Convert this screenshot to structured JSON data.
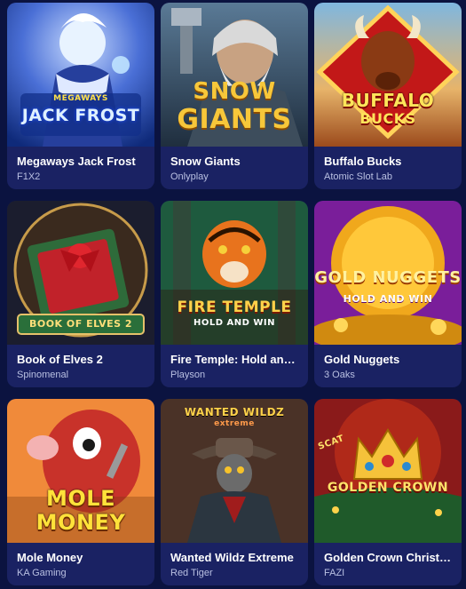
{
  "games": [
    {
      "title": "Megaways Jack Frost",
      "provider": "F1X2",
      "logo_top": "MEGAWAYS",
      "logo_main": "JACK FROST",
      "logo_sub": ""
    },
    {
      "title": "Snow Giants",
      "provider": "Onlyplay",
      "logo_top": "",
      "logo_main": "SNOW",
      "logo_sub": "GIANTS"
    },
    {
      "title": "Buffalo Bucks",
      "provider": "Atomic Slot Lab",
      "logo_top": "",
      "logo_main": "BUFFALO",
      "logo_sub": "BUCKS"
    },
    {
      "title": "Book of Elves 2",
      "provider": "Spinomenal",
      "logo_top": "",
      "logo_main": "BOOK OF ELVES 2",
      "logo_sub": ""
    },
    {
      "title": "Fire Temple: Hold and Win",
      "provider": "Playson",
      "logo_top": "",
      "logo_main": "FIRE TEMPLE",
      "logo_sub": "HOLD AND WIN"
    },
    {
      "title": "Gold Nuggets",
      "provider": "3 Oaks",
      "logo_top": "",
      "logo_main": "GOLD NUGGETS",
      "logo_sub": "HOLD AND WIN"
    },
    {
      "title": "Mole Money",
      "provider": "KA Gaming",
      "logo_top": "",
      "logo_main": "MOLE",
      "logo_sub": "MONEY"
    },
    {
      "title": "Wanted Wildz Extreme",
      "provider": "Red Tiger",
      "logo_top": "",
      "logo_main": "WANTED WILDZ",
      "logo_sub": "extreme"
    },
    {
      "title": "Golden Crown Christmas",
      "provider": "FAZI",
      "logo_top": "",
      "logo_main": "GOLDEN CROWN",
      "logo_sub": "SCAT"
    }
  ],
  "colors": {
    "page_bg": "#0b1340",
    "card_bg": "#1a2263",
    "title": "#ffffff",
    "provider": "#b9c0e2"
  }
}
